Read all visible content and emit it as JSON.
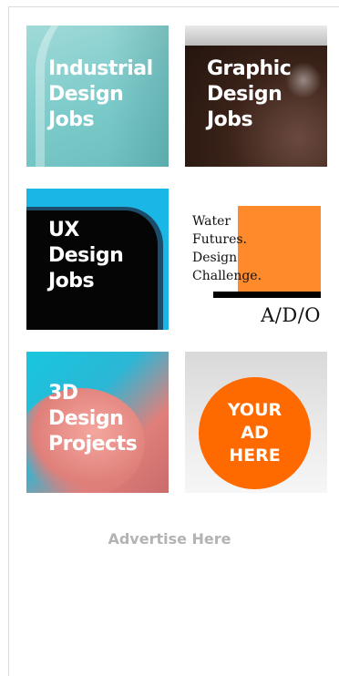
{
  "tiles": [
    {
      "text": "Industrial\nDesign\nJobs"
    },
    {
      "text": "Graphic\nDesign\nJobs"
    },
    {
      "text": "UX\nDesign\nJobs"
    },
    {
      "text": "Water\nFutures.\nDesign\nChallenge.",
      "logo": "A/D/O"
    },
    {
      "text": "3D\nDesign\nProjects"
    },
    {
      "text": "YOUR\nAD\nHERE"
    }
  ],
  "advertise_label": "Advertise Here",
  "colors": {
    "ad_circle": "#ff6a00",
    "water_square": "#ff8a2b",
    "advertise_text": "#b3b3b3"
  }
}
